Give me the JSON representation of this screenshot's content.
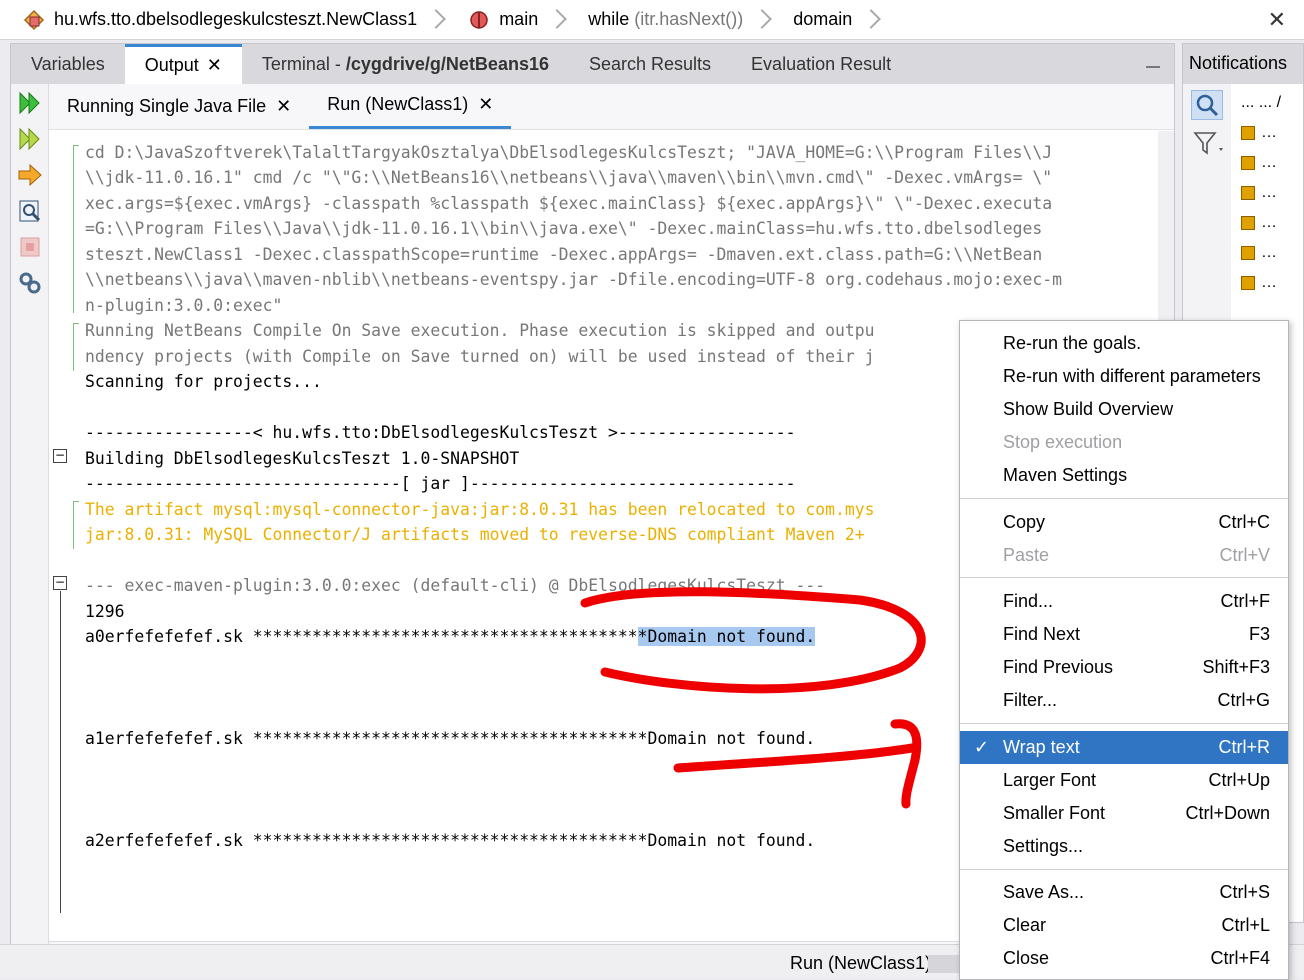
{
  "breadcrumb": {
    "items": [
      {
        "label": "hu.wfs.tto.dbelsodlegeskulcsteszt.NewClass1"
      },
      {
        "label": "main"
      },
      {
        "label": "while",
        "detail": "(itr.hasNext())"
      },
      {
        "label": "domain"
      }
    ]
  },
  "tabs": {
    "variables": "Variables",
    "output": "Output",
    "terminal_prefix": "Terminal - ",
    "terminal_path": "/cygdrive/g/NetBeans16",
    "search": "Search Results",
    "evaluation": "Evaluation Result"
  },
  "subtabs": {
    "single": "Running Single Java File",
    "run": "Run (NewClass1)"
  },
  "console": {
    "lines": [
      "cd D:\\JavaSzoftverek\\TalaltTargyakOsztalya\\DbElsodlegesKulcsTeszt; \"JAVA_HOME=G:\\\\Program Files\\\\J",
      "\\\\jdk-11.0.16.1\" cmd /c \"\\\"G:\\\\NetBeans16\\\\netbeans\\\\java\\\\maven\\\\bin\\\\mvn.cmd\\\" -Dexec.vmArgs= \\\"",
      "xec.args=${exec.vmArgs} -classpath %classpath ${exec.mainClass} ${exec.appArgs}\\\" \\\"-Dexec.executa",
      "=G:\\\\Program Files\\\\Java\\\\jdk-11.0.16.1\\\\bin\\\\java.exe\\\" -Dexec.mainClass=hu.wfs.tto.dbelsodleges",
      "steszt.NewClass1 -Dexec.classpathScope=runtime -Dexec.appArgs= -Dmaven.ext.class.path=G:\\\\NetBean",
      "\\\\netbeans\\\\java\\\\maven-nblib\\\\netbeans-eventspy.jar -Dfile.encoding=UTF-8 org.codehaus.mojo:exec-m",
      "n-plugin:3.0.0:exec\"",
      "Running NetBeans Compile On Save execution. Phase execution is skipped and outpu",
      "ndency projects (with Compile on Save turned on) will be used instead of their j",
      "Scanning for projects...",
      "-----------------< hu.wfs.tto:DbElsodlegesKulcsTeszt >------------------",
      "Building DbElsodlegesKulcsTeszt 1.0-SNAPSHOT",
      "--------------------------------[ jar ]---------------------------------",
      "The artifact mysql:mysql-connector-java:jar:8.0.31 has been relocated to com.mys",
      "jar:8.0.31: MySQL Connector/J artifacts moved to reverse-DNS compliant Maven 2+",
      "--- exec-maven-plugin:3.0.0:exec (default-cli) @ DbElsodlegesKulcsTeszt ---",
      "1296",
      "a0erfefefefef.sk ***************************************",
      "*Domain not found.",
      "a1erfefefefef.sk ****************************************Domain not found.",
      "a2erfefefefef.sk ****************************************Domain not found."
    ]
  },
  "status": {
    "run_label": "Run (NewClass1)"
  },
  "notifications": {
    "title": "Notifications",
    "header_cols": "... ... /"
  },
  "context_menu": {
    "items": [
      {
        "label": "Re-run the goals.",
        "shortcut": ""
      },
      {
        "label": "Re-run with different parameters",
        "shortcut": ""
      },
      {
        "label": "Show Build Overview",
        "shortcut": ""
      },
      {
        "label": "Stop execution",
        "shortcut": ""
      },
      {
        "label": "Maven Settings",
        "shortcut": ""
      },
      {
        "label": "Copy",
        "shortcut": "Ctrl+C"
      },
      {
        "label": "Paste",
        "shortcut": "Ctrl+V"
      },
      {
        "label": "Find...",
        "shortcut": "Ctrl+F"
      },
      {
        "label": "Find Next",
        "shortcut": "F3"
      },
      {
        "label": "Find Previous",
        "shortcut": "Shift+F3"
      },
      {
        "label": "Filter...",
        "shortcut": "Ctrl+G"
      },
      {
        "label": "Wrap text",
        "shortcut": "Ctrl+R"
      },
      {
        "label": "Larger Font",
        "shortcut": "Ctrl+Up"
      },
      {
        "label": "Smaller Font",
        "shortcut": "Ctrl+Down"
      },
      {
        "label": "Settings...",
        "shortcut": ""
      },
      {
        "label": "Save As...",
        "shortcut": "Ctrl+S"
      },
      {
        "label": "Clear",
        "shortcut": "Ctrl+L"
      },
      {
        "label": "Close",
        "shortcut": "Ctrl+F4"
      }
    ],
    "checkmark": "✓"
  },
  "colors": {
    "accent": "#2f75c3",
    "tab_accent": "#3a86d0",
    "warning_text": "#ebb000",
    "highlight": "#a8c9ef",
    "annotation": "#ee0000"
  }
}
